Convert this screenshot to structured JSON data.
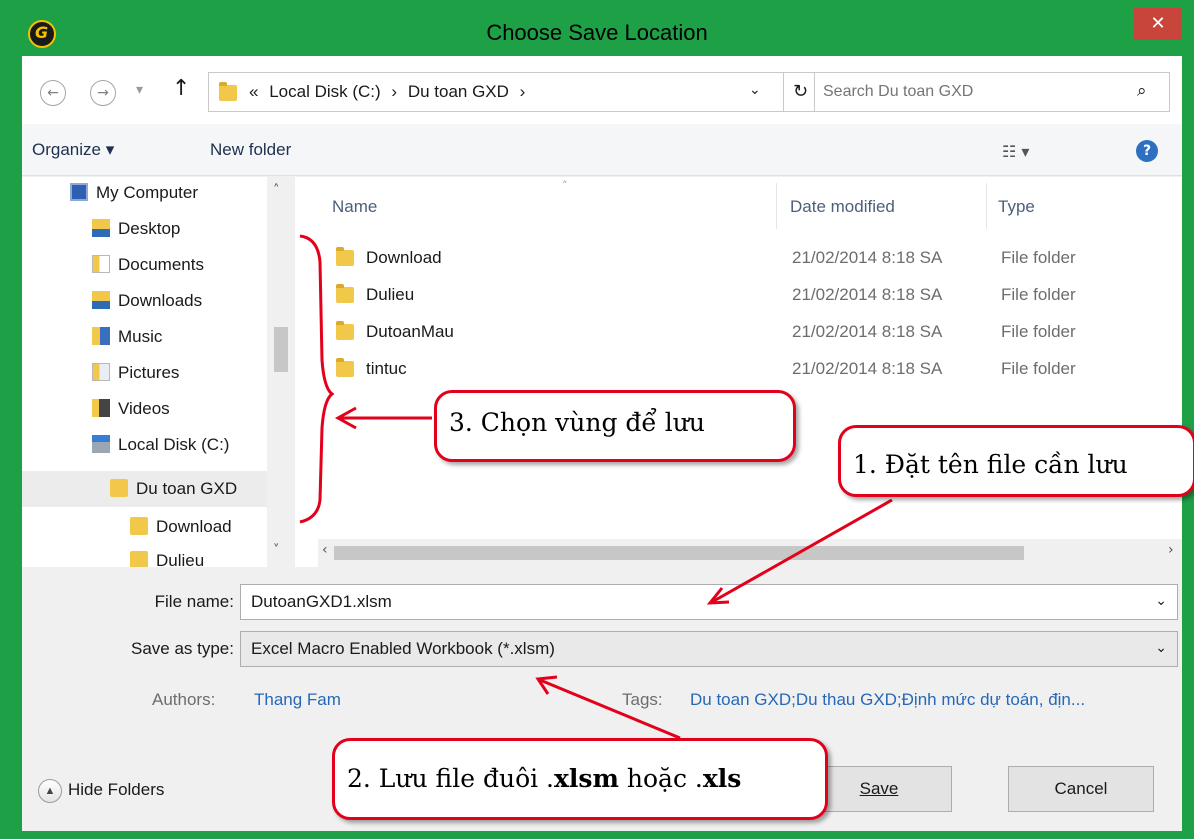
{
  "window": {
    "title": "Choose Save Location",
    "close_glyph": "✕",
    "app_icon": "gxd-logo-icon"
  },
  "address": {
    "back_glyph": "←",
    "forward_glyph": "→",
    "recent_glyph": "▾",
    "up_glyph": "↑",
    "crumbs": [
      "«",
      "Local Disk (C:)",
      "›",
      "Du toan GXD",
      "›"
    ],
    "dropdown_glyph": "⌄",
    "refresh_glyph": "↻"
  },
  "search": {
    "placeholder": "Search Du toan GXD",
    "glyph": "⌕"
  },
  "toolbar": {
    "organize": "Organize ▾",
    "new_folder": "New folder",
    "views_glyph": "☷ ▾",
    "help_glyph": "?"
  },
  "nav": [
    {
      "label": "My Computer",
      "icon": "computer-icon"
    },
    {
      "label": "Desktop",
      "icon": "desktop-icon"
    },
    {
      "label": "Documents",
      "icon": "documents-icon"
    },
    {
      "label": "Downloads",
      "icon": "downloads-icon"
    },
    {
      "label": "Music",
      "icon": "music-icon"
    },
    {
      "label": "Pictures",
      "icon": "pictures-icon"
    },
    {
      "label": "Videos",
      "icon": "videos-icon"
    },
    {
      "label": "Local Disk (C:)",
      "icon": "drive-icon"
    },
    {
      "label": "Du toan GXD",
      "icon": "folder-icon"
    },
    {
      "label": "Download",
      "icon": "folder-icon"
    },
    {
      "label": "Dulieu",
      "icon": "folder-icon"
    }
  ],
  "columns": {
    "name": "Name",
    "date": "Date modified",
    "type": "Type"
  },
  "files": [
    {
      "name": "Download",
      "date": "21/02/2014 8:18 SA",
      "type": "File folder"
    },
    {
      "name": "Dulieu",
      "date": "21/02/2014 8:18 SA",
      "type": "File folder"
    },
    {
      "name": "DutoanMau",
      "date": "21/02/2014 8:18 SA",
      "type": "File folder"
    },
    {
      "name": "tintuc",
      "date": "21/02/2014 8:18 SA",
      "type": "File folder"
    }
  ],
  "form": {
    "file_name_label": "File name:",
    "file_name_value": "DutoanGXD1.xlsm",
    "save_type_label": "Save as type:",
    "save_type_value": "Excel Macro Enabled Workbook (*.xlsm)",
    "authors_label": "Authors:",
    "authors_value": "Thang Fam",
    "tags_label": "Tags:",
    "tags_value": "Du toan GXD;Du thau GXD;Định mức dự toán, địn..."
  },
  "footer": {
    "hide_folders": "Hide Folders",
    "save": "Save",
    "cancel": "Cancel"
  },
  "callouts": {
    "c1": "1. Đặt tên file cần lưu",
    "c2_prefix": "2. Lưu file đuôi .",
    "c2_ext1": "xlsm",
    "c2_mid": " hoặc .",
    "c2_ext2": "xls",
    "c3": "3. Chọn vùng để lưu"
  },
  "colors": {
    "frame": "#1ea046",
    "close": "#c7453a",
    "annotation": "#e3001b",
    "link": "#2668b8"
  }
}
